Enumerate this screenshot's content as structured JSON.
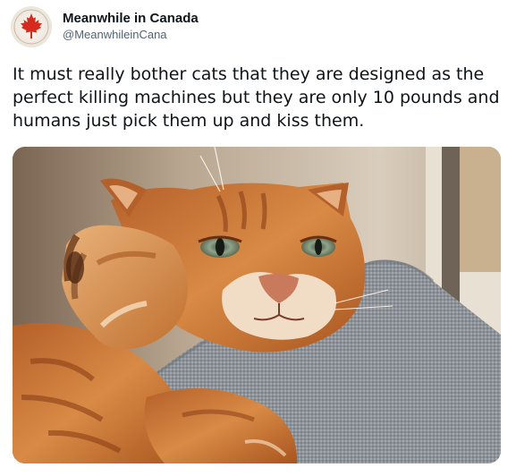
{
  "post": {
    "display_name": "Meanwhile in Canada",
    "handle": "@MeanwhileinCana",
    "text": "It must really bother cats that they are designed as the perfect killing machines but they are only 10 pounds and humans just pick them up and kiss them.",
    "avatar_icon": "maple-leaf-icon",
    "brand_color": "#d52b1e"
  },
  "media": {
    "subject": "orange tabby cat reaching paw toward camera on grey cushion"
  }
}
